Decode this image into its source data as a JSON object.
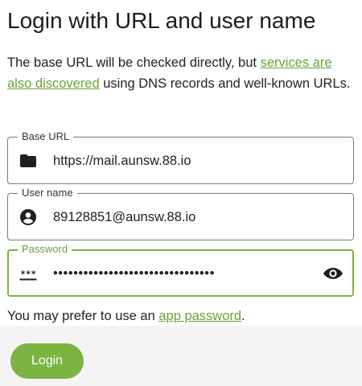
{
  "header": {
    "title": "Login with URL and user name"
  },
  "intro": {
    "text_before": "The base URL will be checked directly, but ",
    "link_text": "services are also discovered",
    "text_after": " using DNS records and well-known URLs."
  },
  "fields": {
    "base_url": {
      "label": "Base URL",
      "value": "https://mail.aunsw.88.io",
      "icon": "folder-icon"
    },
    "user_name": {
      "label": "User name",
      "value": "89128851@aunsw.88.io",
      "icon": "account-circle-icon"
    },
    "password": {
      "label": "Password",
      "value": "••••••••••••••••••••••••••••••••",
      "icon": "password-icon",
      "toggle_icon": "eye-icon"
    }
  },
  "note": {
    "text_before": "You may prefer to use an ",
    "link_text": "app password",
    "text_after": "."
  },
  "actions": {
    "login_label": "Login"
  },
  "colors": {
    "accent": "#7cb342",
    "link": "#6aa13a",
    "border": "#7b7b7b",
    "bottom_bar": "#f4f4f4"
  }
}
